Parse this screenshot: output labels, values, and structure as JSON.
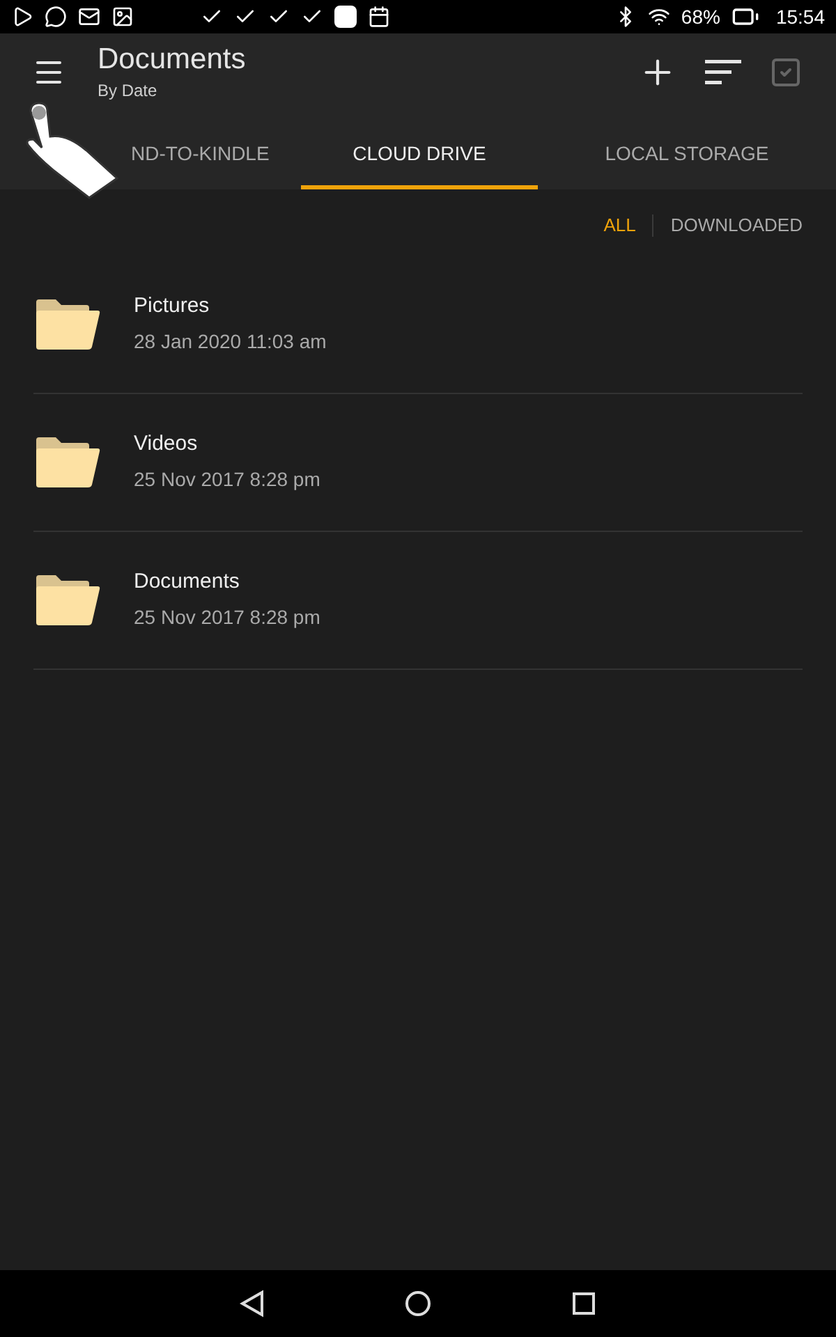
{
  "status_bar": {
    "battery": "68%",
    "time": "15:54"
  },
  "app_bar": {
    "title": "Documents",
    "subtitle": "By Date"
  },
  "tabs": [
    {
      "label": "ND-TO-KINDLE",
      "selected": false
    },
    {
      "label": "CLOUD DRIVE",
      "selected": true
    },
    {
      "label": "LOCAL STORAGE",
      "selected": false
    }
  ],
  "filters": [
    {
      "label": "ALL",
      "selected": true
    },
    {
      "label": "DOWNLOADED",
      "selected": false
    }
  ],
  "folders": [
    {
      "name": "Pictures",
      "date": "28 Jan 2020 11:03 am"
    },
    {
      "name": "Videos",
      "date": "25 Nov 2017 8:28 pm"
    },
    {
      "name": "Documents",
      "date": "25 Nov 2017 8:28 pm"
    }
  ]
}
